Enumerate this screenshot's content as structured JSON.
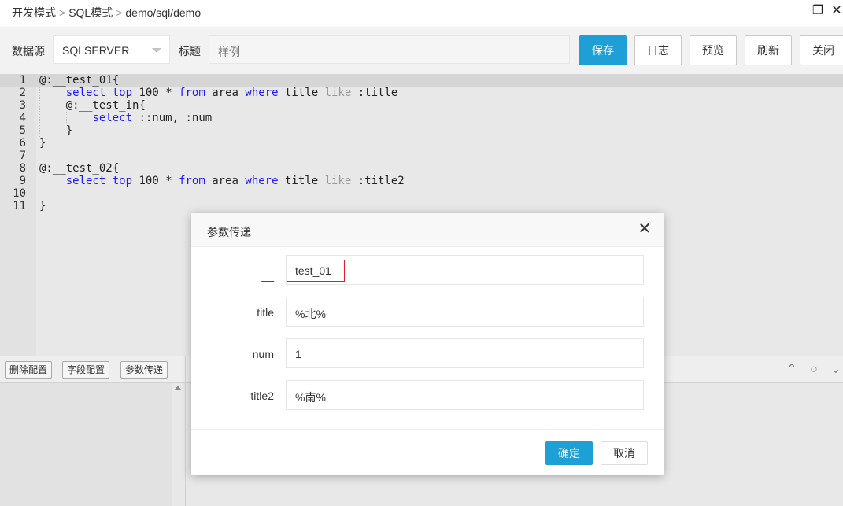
{
  "breadcrumb": [
    "开发模式",
    "SQL模式",
    "demo/sql/demo"
  ],
  "toolbar": {
    "datasource_label": "数据源",
    "datasource_value": "SQLSERVER",
    "title_label": "标题",
    "title_placeholder": "样例",
    "buttons": {
      "save": "保存",
      "log": "日志",
      "preview": "预览",
      "refresh": "刷新",
      "close": "关闭"
    }
  },
  "editor": {
    "lines": [
      {
        "n": "1",
        "text": "@:__test_01{"
      },
      {
        "n": "2",
        "text": "    select top 100 * from area where title like :title"
      },
      {
        "n": "3",
        "text": "    @:__test_in{"
      },
      {
        "n": "4",
        "text": "        select ::num, :num"
      },
      {
        "n": "5",
        "text": "    }"
      },
      {
        "n": "6",
        "text": "}"
      },
      {
        "n": "7",
        "text": ""
      },
      {
        "n": "8",
        "text": "@:__test_02{"
      },
      {
        "n": "9",
        "text": "    select top 100 * from area where title like :title2"
      },
      {
        "n": "10",
        "text": ""
      },
      {
        "n": "11",
        "text": "}"
      }
    ]
  },
  "bottom": {
    "buttons": {
      "delete_config": "删除配置",
      "field_config": "字段配置",
      "param_pass": "参数传递"
    }
  },
  "dialog": {
    "title": "参数传递",
    "fields": [
      {
        "label": "__",
        "value": "test_01"
      },
      {
        "label": "title",
        "value": "%北%"
      },
      {
        "label": "num",
        "value": "1"
      },
      {
        "label": "title2",
        "value": "%南%"
      }
    ],
    "ok": "确定",
    "cancel": "取消"
  }
}
